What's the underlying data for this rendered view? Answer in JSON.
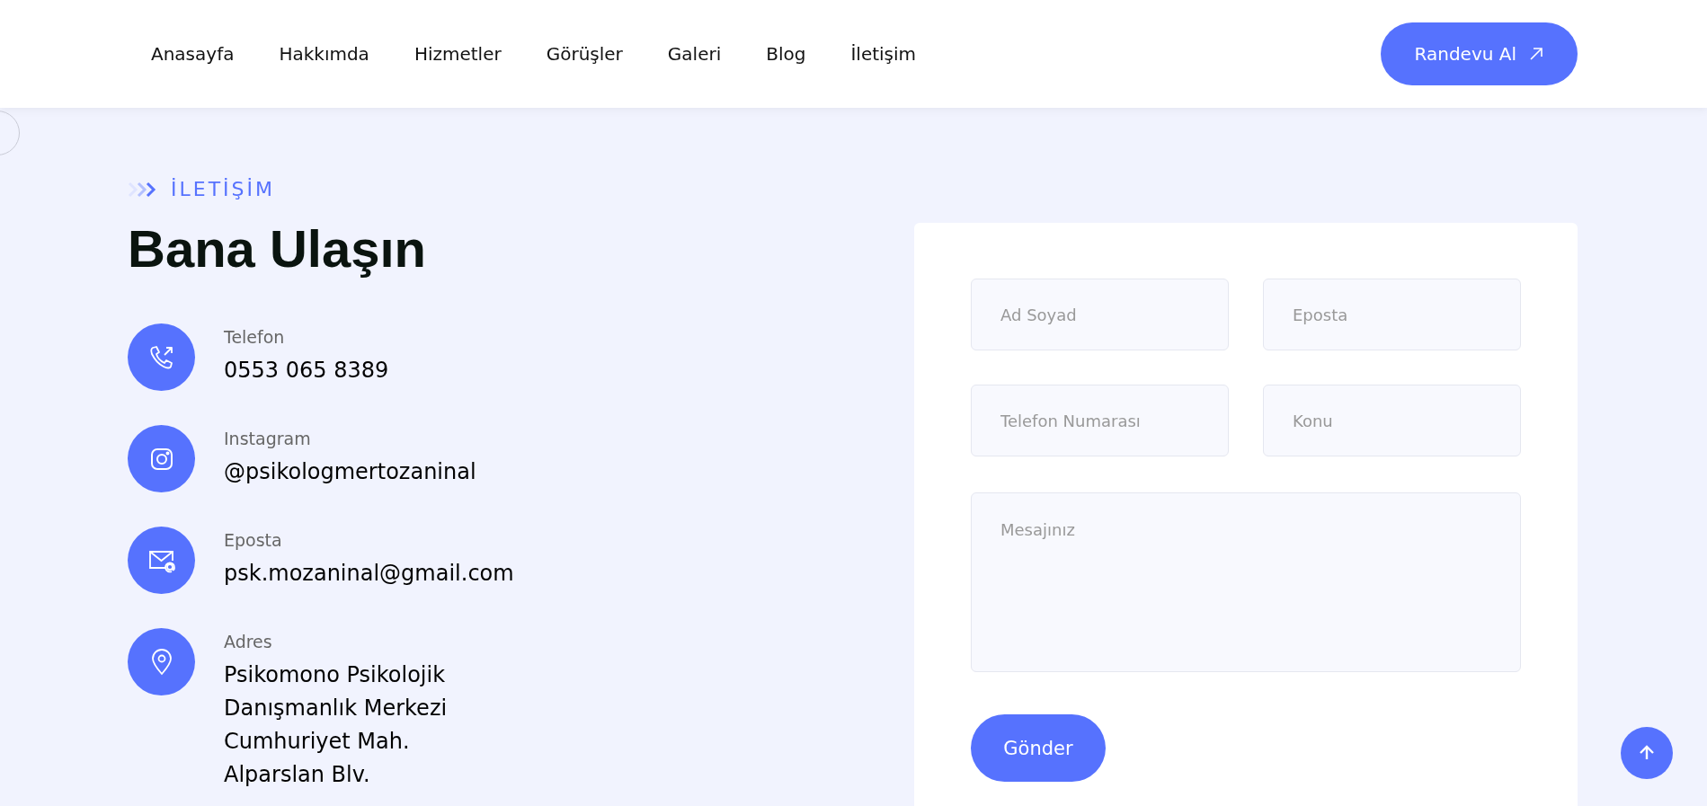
{
  "nav": {
    "items": [
      {
        "label": "Anasayfa"
      },
      {
        "label": "Hakkımda"
      },
      {
        "label": "Hizmetler"
      },
      {
        "label": "Görüşler"
      },
      {
        "label": "Galeri"
      },
      {
        "label": "Blog"
      },
      {
        "label": "İletişim"
      }
    ],
    "cta": "Randevu Al"
  },
  "section": {
    "eyebrow": "İLETİŞİM",
    "title": "Bana Ulaşın"
  },
  "contacts": [
    {
      "kind": "phone",
      "label": "Telefon",
      "lines": [
        "0553 065 8389"
      ]
    },
    {
      "kind": "instagram",
      "label": "Instagram",
      "lines": [
        "@psikologmertozaninal"
      ]
    },
    {
      "kind": "email",
      "label": "Eposta",
      "lines": [
        "psk.mozaninal@gmail.com"
      ]
    },
    {
      "kind": "location",
      "label": "Adres",
      "lines": [
        "Psikomono Psikolojik",
        "Danışmanlık Merkezi",
        "Cumhuriyet Mah.",
        "Alparslan Blv."
      ]
    }
  ],
  "form": {
    "fields": [
      {
        "placeholder": "Ad Soyad"
      },
      {
        "placeholder": "Eposta"
      },
      {
        "placeholder": "Telefon Numarası"
      },
      {
        "placeholder": "Konu"
      }
    ],
    "message": {
      "placeholder": "Mesajınız"
    },
    "submit": "Gönder"
  }
}
